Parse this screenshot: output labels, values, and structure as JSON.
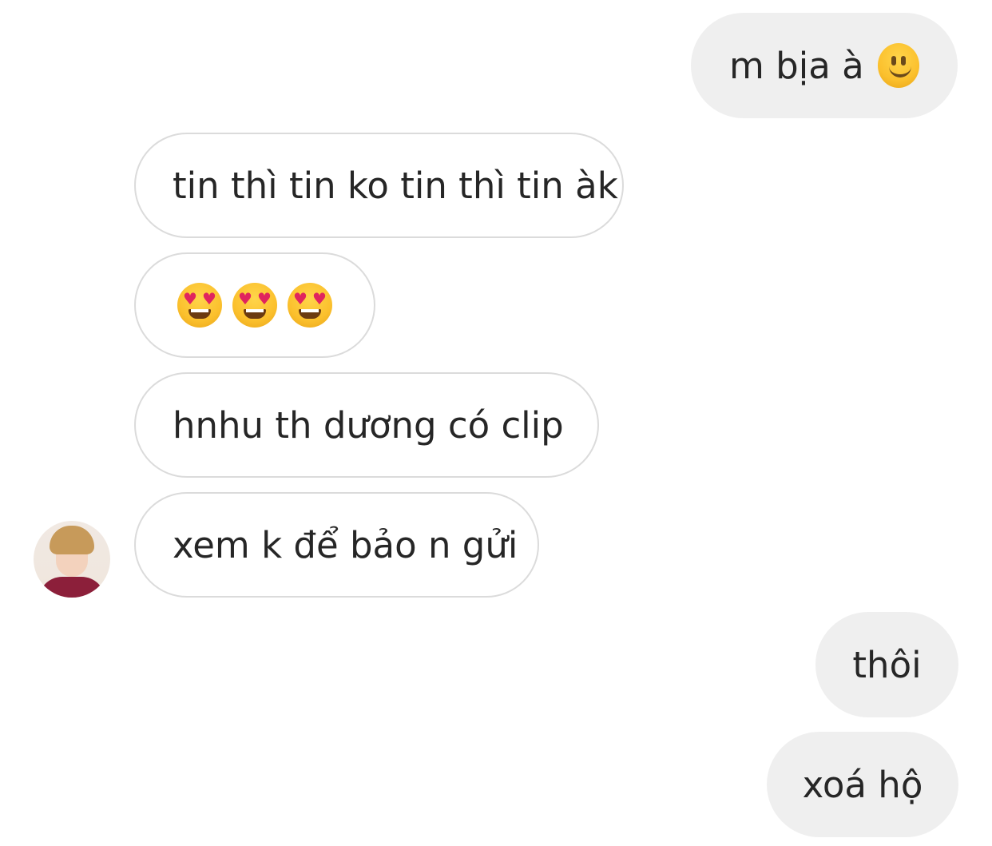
{
  "messages": [
    {
      "side": "sent",
      "text": "m bịa à",
      "emoji": "slightly-smiling-face"
    },
    {
      "side": "received",
      "text": "tin thì tin ko tin thì tin àk"
    },
    {
      "side": "received",
      "emoji": [
        "heart-eyes-face",
        "heart-eyes-face",
        "heart-eyes-face"
      ]
    },
    {
      "side": "received",
      "text": "hnhu th dương có clip"
    },
    {
      "side": "received",
      "text": "xem k để bảo n gửi",
      "avatar": "user-avatar"
    },
    {
      "side": "sent",
      "text": "thôi"
    },
    {
      "side": "sent",
      "text": "xoá hộ"
    }
  ],
  "colors": {
    "sent_bubble": "#efefef",
    "received_border": "#dbdbdb",
    "text": "#262626"
  }
}
